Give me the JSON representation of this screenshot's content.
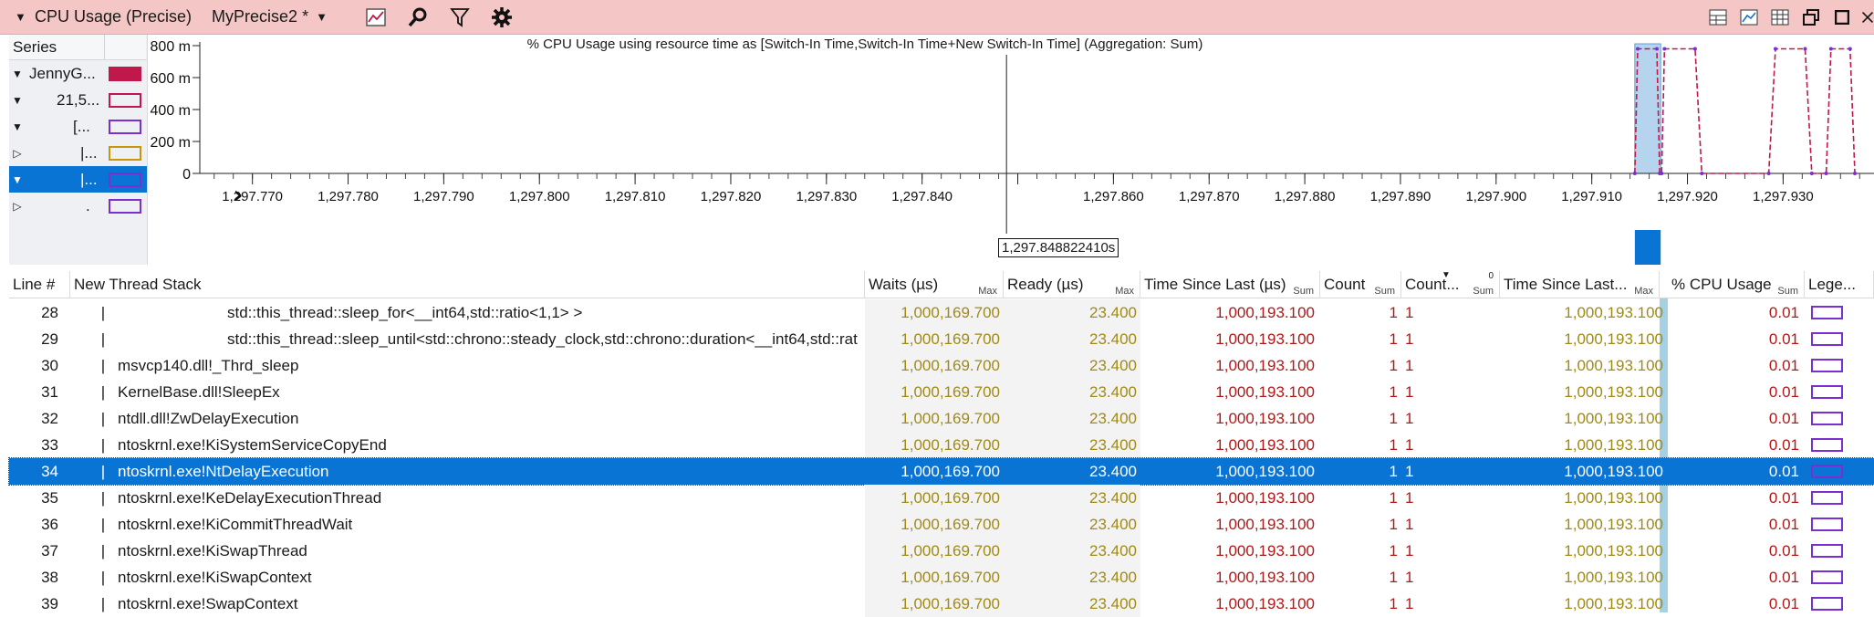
{
  "titlebar": {
    "title": "CPU Usage (Precise)",
    "preset": "MyPrecise2 *",
    "icons": [
      "collapse-caret-icon",
      "preset-dropdown-icon",
      "chart-view-icon",
      "search-icon",
      "filter-icon",
      "settings-gear-icon"
    ],
    "right_icons": [
      "graph-table-icon",
      "graph-only-icon",
      "table-only-icon",
      "restore-window-icon",
      "maximize-icon",
      "close-icon"
    ]
  },
  "series": {
    "header": "Series",
    "rows": [
      {
        "toggle": "▼",
        "label": "JennyG...",
        "color": "#c0184a",
        "filled": true,
        "indent": 4
      },
      {
        "toggle": "▼",
        "label": "21,5...",
        "color": "#c0184a",
        "filled": false,
        "indent": 34
      },
      {
        "toggle": "▼",
        "label": "[...",
        "color": "#7b2fd0",
        "filled": false,
        "indent": 52
      },
      {
        "toggle": "▷",
        "label": "|...",
        "color": "#c7960c",
        "filled": false,
        "indent": 60
      },
      {
        "toggle": "▼",
        "label": "|...",
        "color": "#7b2fd0",
        "filled": false,
        "indent": 60,
        "selected": true
      },
      {
        "toggle": "▷",
        "label": ".",
        "color": "#7b2fd0",
        "filled": false,
        "indent": 66
      }
    ]
  },
  "chart_data": {
    "type": "line",
    "title": "% CPU Usage using resource time as [Switch-In Time,Switch-In Time+New Switch-In Time] (Aggregation: Sum)",
    "xlabel": "",
    "ylabel": "",
    "ylim": [
      0,
      800
    ],
    "yticks": [
      "0",
      "200 m",
      "400 m",
      "600 m",
      "800 m"
    ],
    "xlim": [
      1297.7645,
      1297.9395
    ],
    "xticks": [
      1297.77,
      1297.78,
      1297.79,
      1297.8,
      1297.81,
      1297.82,
      1297.83,
      1297.84,
      1297.85,
      1297.86,
      1297.87,
      1297.88,
      1297.89,
      1297.9,
      1297.91,
      1297.92,
      1297.93
    ],
    "xtick_labels": [
      "1,297.770",
      "1,297.780",
      "1,297.790",
      "1,297.800",
      "1,297.810",
      "1,297.820",
      "1,297.830",
      "1,297.840",
      "",
      "1,297.860",
      "1,297.870",
      "1,297.880",
      "1,297.890",
      "1,297.900",
      "1,297.910",
      "1,297.920",
      "1,297.930"
    ],
    "cursor_x": 1297.84882241,
    "cursor_label": "1,297.848822410s",
    "selection": [
      1297.9145,
      1297.9172
    ],
    "series": [
      {
        "name": "",
        "color": "#c0184a",
        "points": [
          [
            1297.9145,
            0
          ],
          [
            1297.9148,
            780
          ],
          [
            1297.9168,
            780
          ],
          [
            1297.9171,
            0
          ],
          [
            1297.9173,
            0
          ],
          [
            1297.9176,
            780
          ],
          [
            1297.9208,
            780
          ],
          [
            1297.9215,
            0
          ],
          [
            1297.9285,
            0
          ],
          [
            1297.9292,
            780
          ],
          [
            1297.9323,
            780
          ],
          [
            1297.933,
            0
          ],
          [
            1297.9345,
            0
          ],
          [
            1297.935,
            780
          ],
          [
            1297.937,
            780
          ],
          [
            1297.9375,
            0
          ]
        ]
      }
    ]
  },
  "table": {
    "columns": [
      {
        "label": "Line #",
        "agg": ""
      },
      {
        "label": "New Thread Stack",
        "agg": ""
      },
      {
        "label": "Waits (µs)",
        "agg": "Max"
      },
      {
        "label": "Ready (µs)",
        "agg": "Max"
      },
      {
        "label": "Time Since Last (µs)",
        "agg": "Sum"
      },
      {
        "label": "Count",
        "agg": "Sum"
      },
      {
        "label": "Count...",
        "agg": "Sum"
      },
      {
        "label": "Time Since Last...",
        "agg": "Max"
      },
      {
        "label": "% CPU Usage",
        "agg": "Sum"
      },
      {
        "label": "Lege...",
        "agg": ""
      }
    ],
    "sort_indicator": "0",
    "rows": [
      {
        "line": "28",
        "stack": "std::this_thread::sleep_for<__int64,std::ratio<1,1> >",
        "deep": true,
        "waits": "1,000,169.700",
        "ready": "23.400",
        "tsl": "1,000,193.100",
        "count": "1",
        "count2": "1",
        "tsl2": "1,000,193.100",
        "cpu": "0.01"
      },
      {
        "line": "29",
        "stack": "std::this_thread::sleep_until<std::chrono::steady_clock,std::chrono::duration<__int64,std::rat",
        "deep": true,
        "waits": "1,000,169.700",
        "ready": "23.400",
        "tsl": "1,000,193.100",
        "count": "1",
        "count2": "1",
        "tsl2": "1,000,193.100",
        "cpu": "0.01"
      },
      {
        "line": "30",
        "stack": "msvcp140.dll!_Thrd_sleep",
        "deep": false,
        "waits": "1,000,169.700",
        "ready": "23.400",
        "tsl": "1,000,193.100",
        "count": "1",
        "count2": "1",
        "tsl2": "1,000,193.100",
        "cpu": "0.01"
      },
      {
        "line": "31",
        "stack": "KernelBase.dll!SleepEx",
        "deep": false,
        "waits": "1,000,169.700",
        "ready": "23.400",
        "tsl": "1,000,193.100",
        "count": "1",
        "count2": "1",
        "tsl2": "1,000,193.100",
        "cpu": "0.01"
      },
      {
        "line": "32",
        "stack": "ntdll.dll!ZwDelayExecution",
        "deep": false,
        "waits": "1,000,169.700",
        "ready": "23.400",
        "tsl": "1,000,193.100",
        "count": "1",
        "count2": "1",
        "tsl2": "1,000,193.100",
        "cpu": "0.01"
      },
      {
        "line": "33",
        "stack": "ntoskrnl.exe!KiSystemServiceCopyEnd",
        "deep": false,
        "waits": "1,000,169.700",
        "ready": "23.400",
        "tsl": "1,000,193.100",
        "count": "1",
        "count2": "1",
        "tsl2": "1,000,193.100",
        "cpu": "0.01"
      },
      {
        "line": "34",
        "stack": "ntoskrnl.exe!NtDelayExecution",
        "deep": false,
        "selected": true,
        "waits": "1,000,169.700",
        "ready": "23.400",
        "tsl": "1,000,193.100",
        "count": "1",
        "count2": "1",
        "tsl2": "1,000,193.100",
        "cpu": "0.01"
      },
      {
        "line": "35",
        "stack": "ntoskrnl.exe!KeDelayExecutionThread",
        "deep": false,
        "waits": "1,000,169.700",
        "ready": "23.400",
        "tsl": "1,000,193.100",
        "count": "1",
        "count2": "1",
        "tsl2": "1,000,193.100",
        "cpu": "0.01"
      },
      {
        "line": "36",
        "stack": "ntoskrnl.exe!KiCommitThreadWait",
        "deep": false,
        "waits": "1,000,169.700",
        "ready": "23.400",
        "tsl": "1,000,193.100",
        "count": "1",
        "count2": "1",
        "tsl2": "1,000,193.100",
        "cpu": "0.01"
      },
      {
        "line": "37",
        "stack": "ntoskrnl.exe!KiSwapThread",
        "deep": false,
        "waits": "1,000,169.700",
        "ready": "23.400",
        "tsl": "1,000,193.100",
        "count": "1",
        "count2": "1",
        "tsl2": "1,000,193.100",
        "cpu": "0.01"
      },
      {
        "line": "38",
        "stack": "ntoskrnl.exe!KiSwapContext",
        "deep": false,
        "waits": "1,000,169.700",
        "ready": "23.400",
        "tsl": "1,000,193.100",
        "count": "1",
        "count2": "1",
        "tsl2": "1,000,193.100",
        "cpu": "0.01"
      },
      {
        "line": "39",
        "stack": "ntoskrnl.exe!SwapContext",
        "deep": false,
        "waits": "1,000,169.700",
        "ready": "23.400",
        "tsl": "1,000,193.100",
        "count": "1",
        "count2": "1",
        "tsl2": "1,000,193.100",
        "cpu": "0.01"
      }
    ]
  },
  "colors": {
    "titlebar_bg": "#f4c6c6",
    "selection": "#0a74d4",
    "series_line": "#c0184a",
    "series_points": "#7b2fd0",
    "legend_swatch": "#7b2fd0",
    "value_gold": "#a08a16",
    "value_red": "#b01818"
  }
}
